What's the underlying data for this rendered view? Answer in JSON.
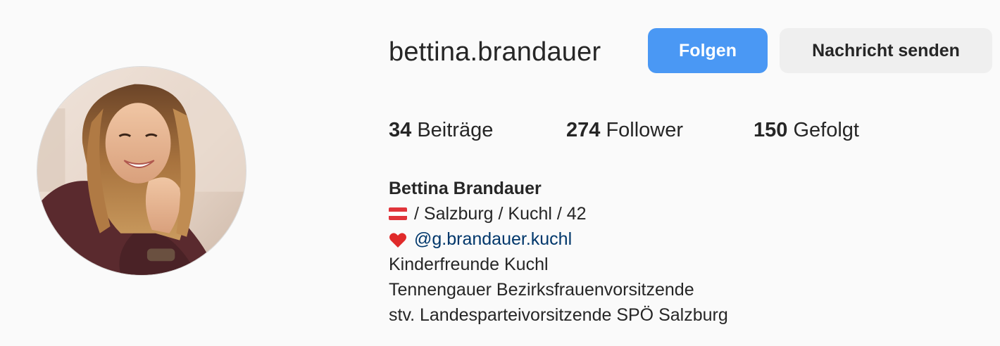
{
  "profile": {
    "username": "bettina.brandauer",
    "full_name": "Bettina Brandauer",
    "avatar_icon": "profile-photo"
  },
  "actions": {
    "follow_label": "Folgen",
    "message_label": "Nachricht senden"
  },
  "stats": {
    "posts_count": "34",
    "posts_label": "Beiträge",
    "followers_count": "274",
    "followers_label": "Follower",
    "following_count": "150",
    "following_label": "Gefolgt"
  },
  "bio": {
    "line1_flag_icon": "austria-flag-icon",
    "line1_text": "/ Salzburg / Kuchl / 42",
    "line2_heart_icon": "red-heart-icon",
    "line2_mention": "@g.brandauer.kuchl",
    "line3": "Kinderfreunde Kuchl",
    "line4": "Tennengauer Bezirksfrauenvorsitzende",
    "line5": "stv. Landesparteivorsitzende SPÖ Salzburg"
  },
  "colors": {
    "background": "#fafafa",
    "follow_button": "#4a98f4",
    "message_button": "#efefef",
    "mention_link": "#00376b",
    "text": "#262626"
  }
}
